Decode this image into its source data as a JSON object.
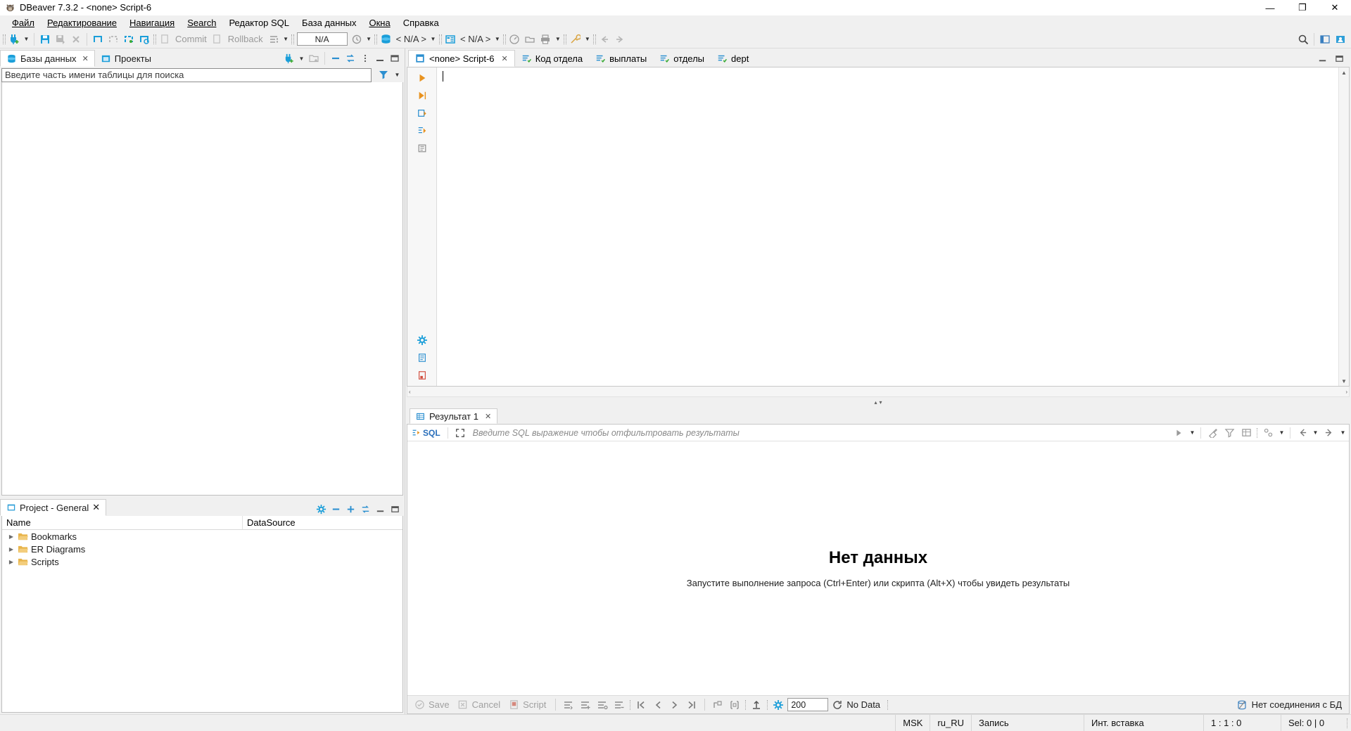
{
  "window": {
    "title": "DBeaver 7.3.2 - <none> Script-6",
    "app_icon": "beaver-icon",
    "minimize": "—",
    "maximize": "❐",
    "close": "✕"
  },
  "menubar": {
    "items": [
      {
        "label": "Файл",
        "mnemonic": "Ф"
      },
      {
        "label": "Редактирование",
        "mnemonic": "Р"
      },
      {
        "label": "Навигация",
        "mnemonic": "Н"
      },
      {
        "label": "Search",
        "mnemonic": "a"
      },
      {
        "label": "Редактор SQL",
        "mnemonic": ""
      },
      {
        "label": "База данных",
        "mnemonic": ""
      },
      {
        "label": "Окна",
        "mnemonic": "О"
      },
      {
        "label": "Справка",
        "mnemonic": "С"
      }
    ]
  },
  "toolbar": {
    "new_connection_icon": "new-connection-icon",
    "dropdown_icon": "chevron-down-icon",
    "save_icon": "save-icon",
    "save_as_icon": "save-as-icon",
    "refresh_disabled_icon": "disconnect-icon",
    "txn_icons": [
      "transaction-mode-icon",
      "transaction-manual-icon",
      "transaction-auto-icon",
      "transaction-log-icon"
    ],
    "commit_label": "Commit",
    "rollback_label": "Rollback",
    "commit_icon": "commit-icon",
    "rollback_icon": "rollback-icon",
    "txn_mode_icon": "txn-mode-icon",
    "na_value": "N/A",
    "history_icon": "history-icon",
    "db_icon": "database-icon",
    "connection_value": "< N/A >",
    "schema_icon": "schema-icon",
    "schema_value": "< N/A >",
    "dashboard_icon": "dashboard-icon",
    "open_icon": "open-folder-icon",
    "print_icon": "print-icon",
    "tools_icon": "tools-icon",
    "back_icon": "back-arrow-icon",
    "forward_icon": "forward-arrow-icon",
    "search_icon": "search-icon",
    "perspective_icon": "perspective-icon",
    "user_icon": "user-perspective-icon"
  },
  "sidebar": {
    "tabs": [
      {
        "label": "Базы данных",
        "icon": "databases-icon",
        "active": true,
        "closable": true
      },
      {
        "label": "Проекты",
        "icon": "projects-icon",
        "active": false,
        "closable": false
      }
    ],
    "tools": [
      "new-connection-icon",
      "chevron-down-icon",
      "new-folder-icon",
      "collapse-all-icon",
      "link-editor-icon",
      "view-menu-icon",
      "minimize-icon",
      "maximize-icon"
    ],
    "search_placeholder": "Введите часть имени таблицы для поиска",
    "filter_icon": "filter-icon",
    "filter_dropdown_icon": "chevron-down-icon"
  },
  "project_panel": {
    "tab_label": "Project - General",
    "tab_icon": "project-icon",
    "tab_closable": true,
    "tools": [
      "settings-icon",
      "collapse-all-icon",
      "expand-icon",
      "link-editor-icon",
      "minimize-icon",
      "maximize-icon"
    ],
    "columns": [
      "Name",
      "DataSource"
    ],
    "rows": [
      {
        "name": "Bookmarks",
        "icon": "folder-icon",
        "datasource": ""
      },
      {
        "name": "ER Diagrams",
        "icon": "folder-icon",
        "datasource": ""
      },
      {
        "name": "Scripts",
        "icon": "folder-icon",
        "datasource": ""
      }
    ]
  },
  "editor": {
    "tabs": [
      {
        "label": "<none> Script-6",
        "icon": "sql-script-icon",
        "active": true,
        "closable": true
      },
      {
        "label": "Код отдела",
        "icon": "sql-saved-icon",
        "active": false,
        "closable": false
      },
      {
        "label": "выплаты",
        "icon": "sql-saved-icon",
        "active": false,
        "closable": false
      },
      {
        "label": "отделы",
        "icon": "sql-saved-icon",
        "active": false,
        "closable": false
      },
      {
        "label": "dept",
        "icon": "sql-saved-icon",
        "active": false,
        "closable": false
      }
    ],
    "tab_tools": [
      "minimize-icon",
      "maximize-icon"
    ],
    "rail_icons": [
      "execute-statement-icon",
      "execute-script-icon",
      "execute-new-tab-icon",
      "execute-expression-icon",
      "execute-plan-icon"
    ],
    "rail_bottom_icons": [
      "settings-icon",
      "format-icon",
      "disable-icon"
    ],
    "content": "",
    "scroll_up_icon": "▲",
    "scroll_down_icon": "▼",
    "collapse_up_icon": "▴",
    "collapse_down_icon": "▾",
    "hscroll_left_icon": "‹",
    "hscroll_right_icon": "›"
  },
  "results": {
    "tab_label": "Результат 1",
    "tab_icon": "grid-icon",
    "tab_closable": true,
    "filter": {
      "sql_label": "SQL",
      "sql_icon": "sql-filter-icon",
      "expand_icon": "expand-filter-icon",
      "placeholder": "Введите SQL выражение чтобы отфильтровать результаты",
      "apply_icon": "apply-filter-icon",
      "history_icon": "chevron-down-icon",
      "right_icons": [
        "clear-filter-icon",
        "filter-settings-icon",
        "grid-config-icon",
        "panels-icon",
        "chevron-down-icon",
        "prev-icon",
        "chevron-down-icon",
        "next-icon",
        "chevron-down-icon"
      ]
    },
    "empty_title": "Нет данных",
    "empty_subtitle": "Запустите выполнение запроса (Ctrl+Enter) или скрипта (Alt+X) чтобы увидеть результаты",
    "toolbar": {
      "save_label": "Save",
      "save_icon": "save-check-icon",
      "cancel_label": "Cancel",
      "cancel_icon": "cancel-icon",
      "script_label": "Script",
      "script_icon": "script-icon",
      "row_icons": [
        "add-row-icon",
        "duplicate-row-icon",
        "delete-row-icon",
        "edit-row-icon"
      ],
      "nav_first_icon": "❘❮",
      "nav_prev_icon": "❮",
      "nav_next_icon": "❯",
      "nav_last_icon": "❯❘",
      "calc_icons": [
        "calc-icon",
        "panel-icon"
      ],
      "export_icon": "export-icon",
      "settings_icon": "settings-icon",
      "fetch_size": "200",
      "refresh_icon": "refresh-icon",
      "status_label": "No Data",
      "connection_icon": "no-connection-icon",
      "connection_label": "Нет соединения с БД"
    }
  },
  "statusbar": {
    "timezone": "MSK",
    "locale": "ru_RU",
    "mode": "Запись",
    "insert_mode": "Инт. вставка",
    "position": "1 : 1 : 0",
    "selection": "Sel: 0 | 0"
  }
}
